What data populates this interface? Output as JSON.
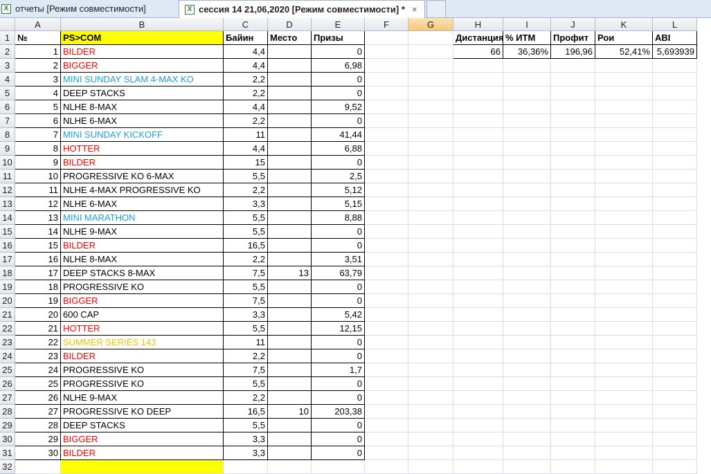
{
  "tabs": [
    {
      "label": "отчеты  [Режим совместимости]"
    },
    {
      "label": "сессия 14 21,06,2020  [Режим совместимости] *",
      "close": "×"
    }
  ],
  "columns": [
    "A",
    "B",
    "C",
    "D",
    "E",
    "F",
    "G",
    "H",
    "I",
    "J",
    "K",
    "L"
  ],
  "selected_column": "G",
  "header": {
    "num": "№",
    "name": "PS>COM",
    "buyin": "Байин",
    "place": "Место",
    "prize": "Призы"
  },
  "rows": [
    {
      "n": "1",
      "name": "BILDER",
      "buyin": "4,4",
      "place": "",
      "prize": "0",
      "color": "red"
    },
    {
      "n": "2",
      "name": "BIGGER",
      "buyin": "4,4",
      "place": "",
      "prize": "6,98",
      "color": "red"
    },
    {
      "n": "3",
      "name": "MINI SUNDAY SLAM 4-MAX KO",
      "buyin": "2,2",
      "place": "",
      "prize": "0",
      "color": "blue"
    },
    {
      "n": "4",
      "name": "DEEP STACKS",
      "buyin": "2,2",
      "place": "",
      "prize": "0",
      "color": "black"
    },
    {
      "n": "5",
      "name": "NLHE 8-MAX",
      "buyin": "4,4",
      "place": "",
      "prize": "9,52",
      "color": "black"
    },
    {
      "n": "6",
      "name": "NLHE 6-MAX",
      "buyin": "2,2",
      "place": "",
      "prize": "0",
      "color": "black"
    },
    {
      "n": "7",
      "name": "MINI SUNDAY KICKOFF",
      "buyin": "11",
      "place": "",
      "prize": "41,44",
      "color": "blue"
    },
    {
      "n": "8",
      "name": "HOTTER",
      "buyin": "4,4",
      "place": "",
      "prize": "6,88",
      "color": "red"
    },
    {
      "n": "9",
      "name": "BILDER",
      "buyin": "15",
      "place": "",
      "prize": "0",
      "color": "red"
    },
    {
      "n": "10",
      "name": "PROGRESSIVE KO 6-MAX",
      "buyin": "5,5",
      "place": "",
      "prize": "2,5",
      "color": "black"
    },
    {
      "n": "11",
      "name": "NLHE 4-MAX PROGRESSIVE KO",
      "buyin": "2,2",
      "place": "",
      "prize": "5,12",
      "color": "black"
    },
    {
      "n": "12",
      "name": "NLHE 6-MAX",
      "buyin": "3,3",
      "place": "",
      "prize": "5,15",
      "color": "black"
    },
    {
      "n": "13",
      "name": "MINI MARATHON",
      "buyin": "5,5",
      "place": "",
      "prize": "8,88",
      "color": "blue"
    },
    {
      "n": "14",
      "name": "NLHE 9-MAX",
      "buyin": "5,5",
      "place": "",
      "prize": "0",
      "color": "black"
    },
    {
      "n": "15",
      "name": "BILDER",
      "buyin": "16,5",
      "place": "",
      "prize": "0",
      "color": "red"
    },
    {
      "n": "16",
      "name": "NLHE 8-MAX",
      "buyin": "2,2",
      "place": "",
      "prize": "3,51",
      "color": "black"
    },
    {
      "n": "17",
      "name": "DEEP STACKS 8-MAX",
      "buyin": "7,5",
      "place": "13",
      "prize": "63,79",
      "color": "black"
    },
    {
      "n": "18",
      "name": "PROGRESSIVE KO",
      "buyin": "5,5",
      "place": "",
      "prize": "0",
      "color": "black"
    },
    {
      "n": "19",
      "name": "BIGGER",
      "buyin": "7,5",
      "place": "",
      "prize": "0",
      "color": "red"
    },
    {
      "n": "20",
      "name": "600 CAP",
      "buyin": "3,3",
      "place": "",
      "prize": "5,42",
      "color": "black"
    },
    {
      "n": "21",
      "name": "HOTTER",
      "buyin": "5,5",
      "place": "",
      "prize": "12,15",
      "color": "red"
    },
    {
      "n": "22",
      "name": "SUMMER SERIES 143",
      "buyin": "11",
      "place": "",
      "prize": "0",
      "color": "gold"
    },
    {
      "n": "23",
      "name": "BILDER",
      "buyin": "2,2",
      "place": "",
      "prize": "0",
      "color": "red"
    },
    {
      "n": "24",
      "name": "PROGRESSIVE KO",
      "buyin": "7,5",
      "place": "",
      "prize": "1,7",
      "color": "black"
    },
    {
      "n": "25",
      "name": "PROGRESSIVE KO",
      "buyin": "5,5",
      "place": "",
      "prize": "0",
      "color": "black"
    },
    {
      "n": "26",
      "name": "NLHE 9-MAX",
      "buyin": "2,2",
      "place": "",
      "prize": "0",
      "color": "black"
    },
    {
      "n": "27",
      "name": "PROGRESSIVE KO DEEP",
      "buyin": "16,5",
      "place": "10",
      "prize": "203,38",
      "color": "black"
    },
    {
      "n": "28",
      "name": "DEEP STACKS",
      "buyin": "5,5",
      "place": "",
      "prize": "0",
      "color": "black"
    },
    {
      "n": "29",
      "name": "BIGGER",
      "buyin": "3,3",
      "place": "",
      "prize": "0",
      "color": "red"
    },
    {
      "n": "30",
      "name": "BILDER",
      "buyin": "3,3",
      "place": "",
      "prize": "0",
      "color": "red"
    }
  ],
  "stats": {
    "headers": [
      "Дистанция",
      "% ИТМ",
      "Профит",
      "Рои",
      "ABI"
    ],
    "values": [
      "66",
      "36,36%",
      "196,96",
      "52,41%",
      "5,693939"
    ]
  },
  "colors": {
    "red": "#ff0000",
    "blue": "#1e9dd8",
    "gold": "#f2c200",
    "highlight": "#ffff00"
  }
}
